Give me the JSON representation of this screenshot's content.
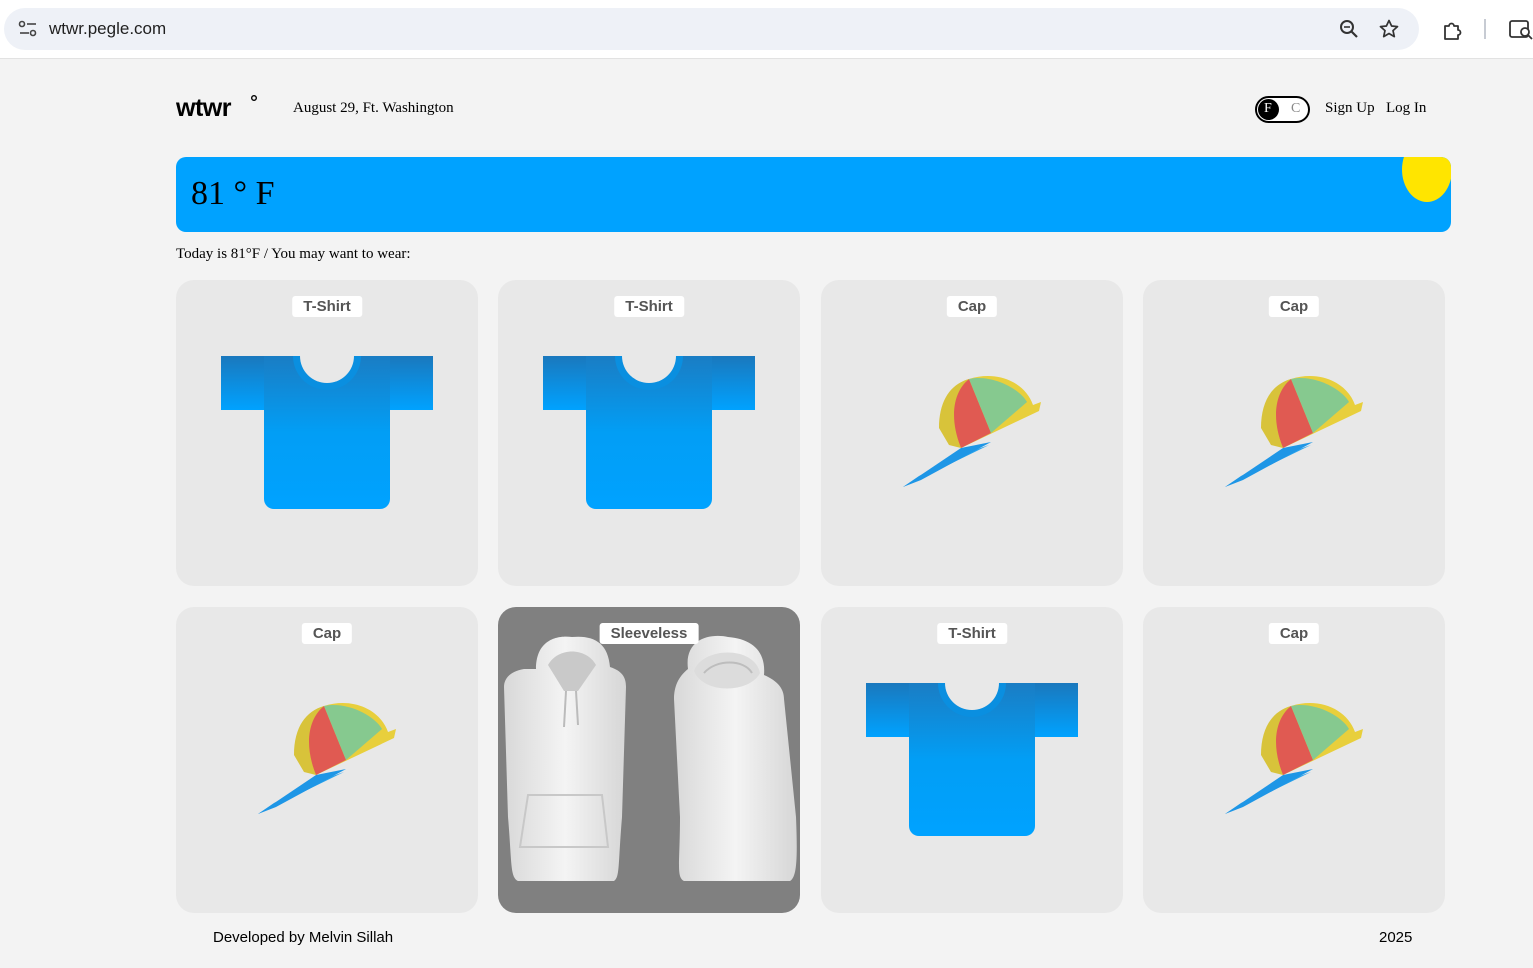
{
  "browser": {
    "url": "wtwr.pegle.com"
  },
  "header": {
    "logo_text": "wtwr°",
    "date_location": "August 29, Ft. Washington",
    "unit_toggle": {
      "option_f": "F",
      "option_c": "C",
      "selected": "F"
    },
    "signup_label": "Sign Up",
    "login_label": "Log In"
  },
  "weather": {
    "temperature": "81 ° F",
    "condition": "sunny"
  },
  "recommendation_text": "Today is 81°F / You may want to wear:",
  "items": [
    {
      "name": "T-Shirt",
      "kind": "tshirt"
    },
    {
      "name": "T-Shirt",
      "kind": "tshirt"
    },
    {
      "name": "Cap",
      "kind": "cap"
    },
    {
      "name": "Cap",
      "kind": "cap"
    },
    {
      "name": "Cap",
      "kind": "cap"
    },
    {
      "name": "Sleeveless",
      "kind": "sleeveless"
    },
    {
      "name": "T-Shirt",
      "kind": "tshirt"
    },
    {
      "name": "Cap",
      "kind": "cap"
    }
  ],
  "footer": {
    "developer": "Developed by Melvin Sillah",
    "year": "2025"
  },
  "colors": {
    "weather_bar": "#00a2ff",
    "sun": "#ffe500",
    "card_bg": "#e8e8e8"
  }
}
